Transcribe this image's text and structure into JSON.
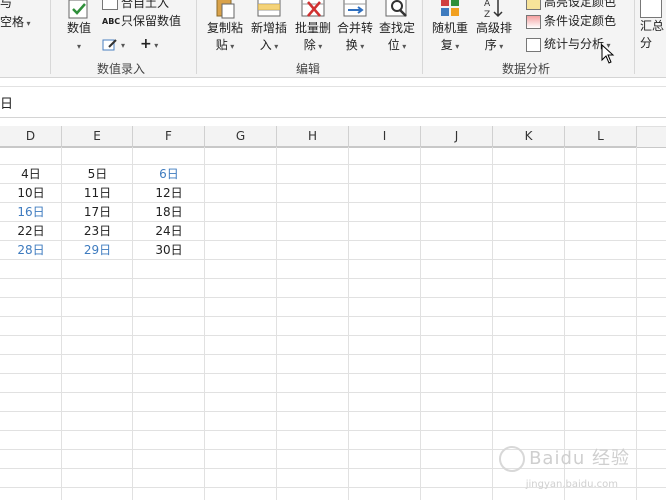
{
  "ribbon": {
    "left_partial": {
      "label1": "与",
      "label2": "空格"
    },
    "numeric_group": {
      "label": "数值录入",
      "numeric_button": "数值",
      "insert_text_partial": "合自土入",
      "keep_numeric": "只保留数值"
    },
    "edit_group": {
      "label": "编辑",
      "copy_paste": [
        "复制粘",
        "贴"
      ],
      "add_insert": [
        "新增插",
        "入"
      ],
      "batch_delete": [
        "批量删",
        "除"
      ],
      "merge_convert": [
        "合并转",
        "换"
      ],
      "find_locate": [
        "查找定",
        "位"
      ]
    },
    "analysis_group": {
      "label": "数据分析",
      "random_repeat": [
        "随机重",
        "复"
      ],
      "advanced_sort": [
        "高级排",
        "序"
      ],
      "highlight_color_partial": "高亮设定颜色",
      "conditional_color": "条件设定颜色",
      "stats_analysis": "统计与分析"
    },
    "right_partial": [
      "汇总",
      "分"
    ]
  },
  "formula_bar": {
    "text": "日"
  },
  "columns": [
    "D",
    "E",
    "F",
    "G",
    "H",
    "I",
    "J",
    "K",
    "L"
  ],
  "rows": [
    {
      "d": "4日",
      "e": "5日",
      "f": "6日"
    },
    {
      "d": "10日",
      "e": "11日",
      "f": "12日"
    },
    {
      "d": "16日",
      "e": "17日",
      "f": "18日"
    },
    {
      "d": "22日",
      "e": "23日",
      "f": "24日"
    },
    {
      "d": "28日",
      "e": "29日",
      "f": "30日"
    }
  ],
  "colors": {
    "weekend_blue": "#3e7bbf",
    "normal": "#222222"
  },
  "watermark": {
    "text": "Baidu 经验",
    "url": "jingyan.baidu.com"
  }
}
